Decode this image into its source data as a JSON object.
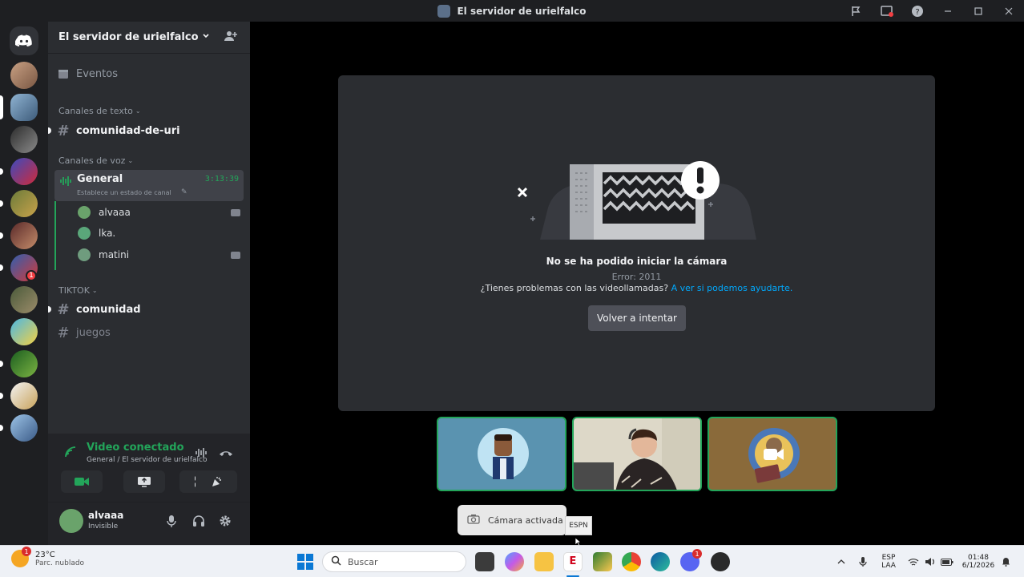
{
  "window": {
    "title": "El servidor de urielfalco",
    "controls": [
      "flag-icon",
      "inbox-icon",
      "help-icon",
      "minimize",
      "maximize",
      "close"
    ]
  },
  "rail": {
    "home_icon": "discord-logo-icon",
    "server_count": 13,
    "badges": [
      "1"
    ]
  },
  "server": {
    "name": "El servidor de urielfalco",
    "add_member_icon": "add-member-icon",
    "events_label": "Eventos",
    "categories": [
      {
        "name": "Canales de texto",
        "channels": [
          {
            "name": "comunidad-de-uri",
            "unread": true
          }
        ]
      },
      {
        "name": "Canales de voz",
        "channels": [
          {
            "name": "General",
            "timer": "3:13:39",
            "status_placeholder": "Establece un estado de canal",
            "users": [
              {
                "name": "alvaaa",
                "camera": true
              },
              {
                "name": "lka.",
                "camera": false
              },
              {
                "name": "matini",
                "camera": true
              }
            ]
          }
        ]
      },
      {
        "name": "TIKTOK",
        "channels": [
          {
            "name": "comunidad",
            "unread": true
          },
          {
            "name": "juegos",
            "unread": false
          }
        ]
      }
    ]
  },
  "voice_panel": {
    "status": "Video conectado",
    "location": "General / El servidor de urielfalco",
    "buttons": [
      "camera-icon",
      "screen-share-icon",
      "activities-icon",
      "soundboard-icon"
    ]
  },
  "user_panel": {
    "name": "alvaaa",
    "status": "Invisible",
    "icons": [
      "microphone-icon",
      "headphones-icon",
      "settings-icon"
    ]
  },
  "stage": {
    "error_title": "No se ha podido iniciar la cámara",
    "error_code": "Error: 2011",
    "help_text": "¿Tienes problemas con las videollamadas?",
    "help_link": "A ver si podemos ayudarte.",
    "retry_label": "Volver a intentar",
    "toast": "Cámara activada",
    "tooltip": "ESPN"
  },
  "taskbar": {
    "weather_temp": "23°C",
    "weather_desc": "Parc. nublado",
    "weather_badge": "1",
    "search_placeholder": "Buscar",
    "lang_top": "ESP",
    "lang_bottom": "LAA",
    "time": "01:48",
    "date": "6/1/2026",
    "discord_badge": "1"
  }
}
